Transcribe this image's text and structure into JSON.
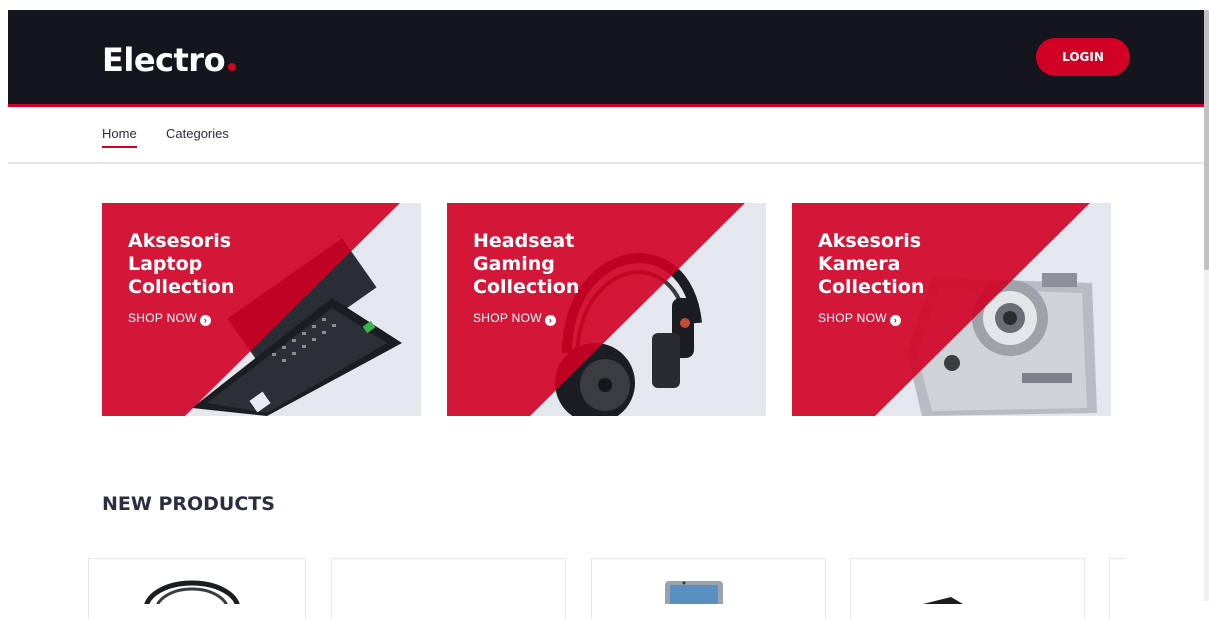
{
  "header": {
    "logo_text": "Electro",
    "login_label": "LOGIN"
  },
  "nav": {
    "items": [
      {
        "label": "Home",
        "active": true
      },
      {
        "label": "Categories",
        "active": false
      }
    ]
  },
  "collections": [
    {
      "title_lines": [
        "Aksesoris",
        "Laptop",
        "Collection"
      ],
      "link": "SHOP NOW",
      "image": "laptop"
    },
    {
      "title_lines": [
        "Headseat",
        "Gaming",
        "Collection"
      ],
      "link": "SHOP NOW",
      "image": "headphones"
    },
    {
      "title_lines": [
        "Aksesoris",
        "Kamera",
        "Collection"
      ],
      "link": "SHOP NOW",
      "image": "camera"
    }
  ],
  "new_products": {
    "title": "NEW PRODUCTS",
    "items": [
      {
        "image": "headphones"
      },
      {
        "image": "empty"
      },
      {
        "image": "smartphone"
      },
      {
        "image": "dark-product"
      },
      {
        "image": "partial"
      }
    ]
  },
  "colors": {
    "accent": "#d10024",
    "header_bg": "#15161d",
    "card_bg": "#e4e7ed"
  },
  "icons": [
    "arrow-circle-right-icon"
  ]
}
